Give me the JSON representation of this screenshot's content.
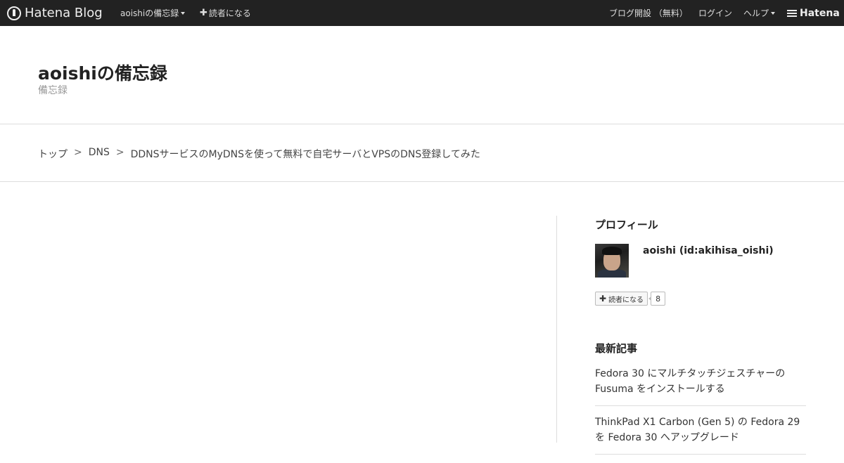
{
  "topbar": {
    "logo_text": "Hatena Blog",
    "blog_menu": "aoishiの備忘録",
    "subscribe": "読者になる",
    "open_blog": "ブログ開設 （無料）",
    "login": "ログイン",
    "help": "ヘルプ",
    "brand": "Hatena"
  },
  "header": {
    "title": "aoishiの備忘録",
    "description": "備忘録"
  },
  "breadcrumb": {
    "items": [
      "トップ",
      "DNS",
      "DDNSサービスのMyDNSを使って無料で自宅サーバとVPSのDNS登録してみた"
    ],
    "separator": ">"
  },
  "sidebar": {
    "profile": {
      "title": "プロフィール",
      "name": "aoishi (id:akihisa_oishi)",
      "subscribe_label": "読者になる",
      "subscriber_count": "8"
    },
    "recent": {
      "title": "最新記事",
      "items": [
        "Fedora 30 にマルチタッチジェスチャーの Fusuma をインストールする",
        "ThinkPad X1 Carbon (Gen 5) の Fedora 29 を Fedora 30 へアップグレード"
      ]
    }
  },
  "colors": {
    "topbar_bg": "#222222",
    "border": "#dddddd",
    "muted_text": "#999999"
  }
}
